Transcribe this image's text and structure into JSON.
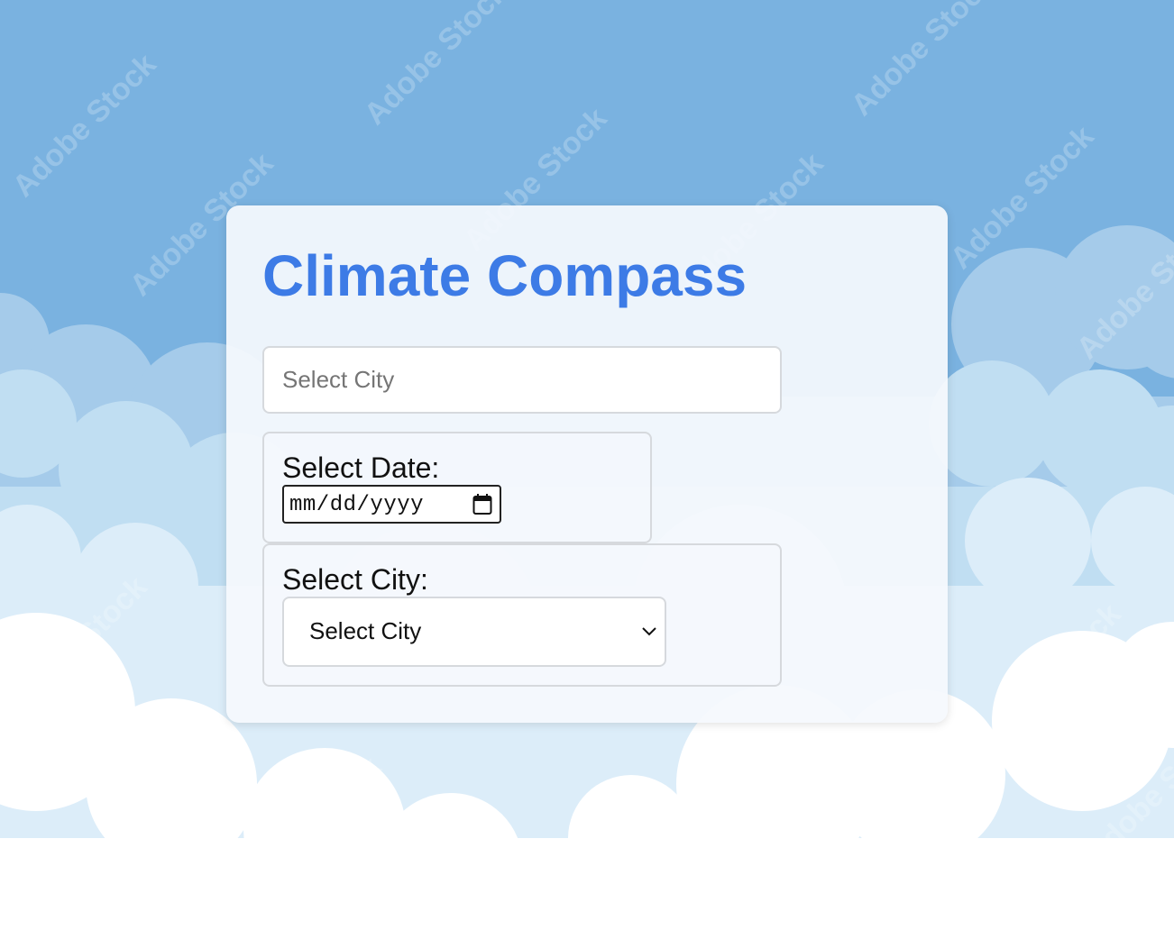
{
  "app": {
    "title": "Climate Compass"
  },
  "search": {
    "placeholder": "Select City"
  },
  "date_picker": {
    "label": "Select Date:",
    "value_display": "mm/dd/yyyy",
    "icon": "calendar-icon"
  },
  "city_select": {
    "label": "Select City:",
    "selected": "Select City",
    "icon": "chevron-down-icon"
  },
  "background": {
    "watermark_text": "Adobe Stock"
  },
  "colors": {
    "accent": "#3d7be6",
    "sky": "#7ab2e0",
    "card": "#f5f9fd"
  }
}
